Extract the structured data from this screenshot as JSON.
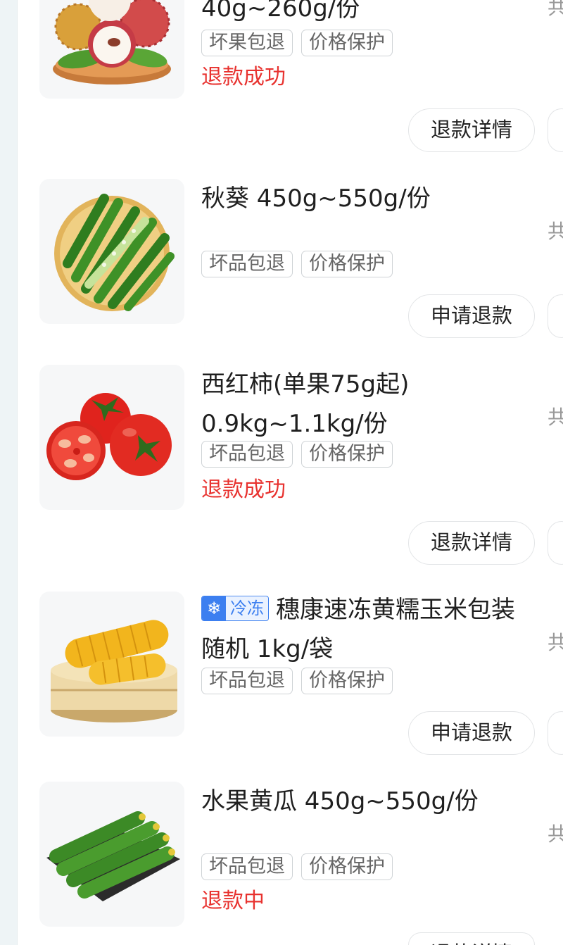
{
  "items": [
    {
      "title": "40g~260g/份",
      "tags": [
        "坏果包退",
        "价格保护"
      ],
      "status": "退款成功",
      "button": "退款详情",
      "gong": "共"
    },
    {
      "title": "秋葵 450g~550g/份",
      "tags": [
        "坏品包退",
        "价格保护"
      ],
      "status": "",
      "button": "申请退款",
      "gong": "共"
    },
    {
      "title": "西红柿(单果75g起) 0.9kg~1.1kg/份",
      "tags": [
        "坏品包退",
        "价格保护"
      ],
      "status": "退款成功",
      "button": "退款详情",
      "gong": "共"
    },
    {
      "badge_icon": "❄",
      "badge_text": "冷冻",
      "title": "穗康速冻黄糯玉米包装随机 1kg/袋",
      "tags": [
        "坏品包退",
        "价格保护"
      ],
      "status": "",
      "button": "申请退款",
      "gong": "共"
    },
    {
      "title": "水果黄瓜 450g~550g/份",
      "tags": [
        "坏品包退",
        "价格保护"
      ],
      "status": "退款中",
      "button": "退款详情",
      "gong": "共"
    }
  ],
  "colors": {
    "status_red": "#e8322f",
    "frozen_blue": "#3c7ff0",
    "tag_border": "#cfd3d6"
  },
  "icons": [
    "lychee-image",
    "okra-image",
    "tomato-image",
    "corn-image",
    "cucumber-image",
    "snowflake-icon"
  ]
}
